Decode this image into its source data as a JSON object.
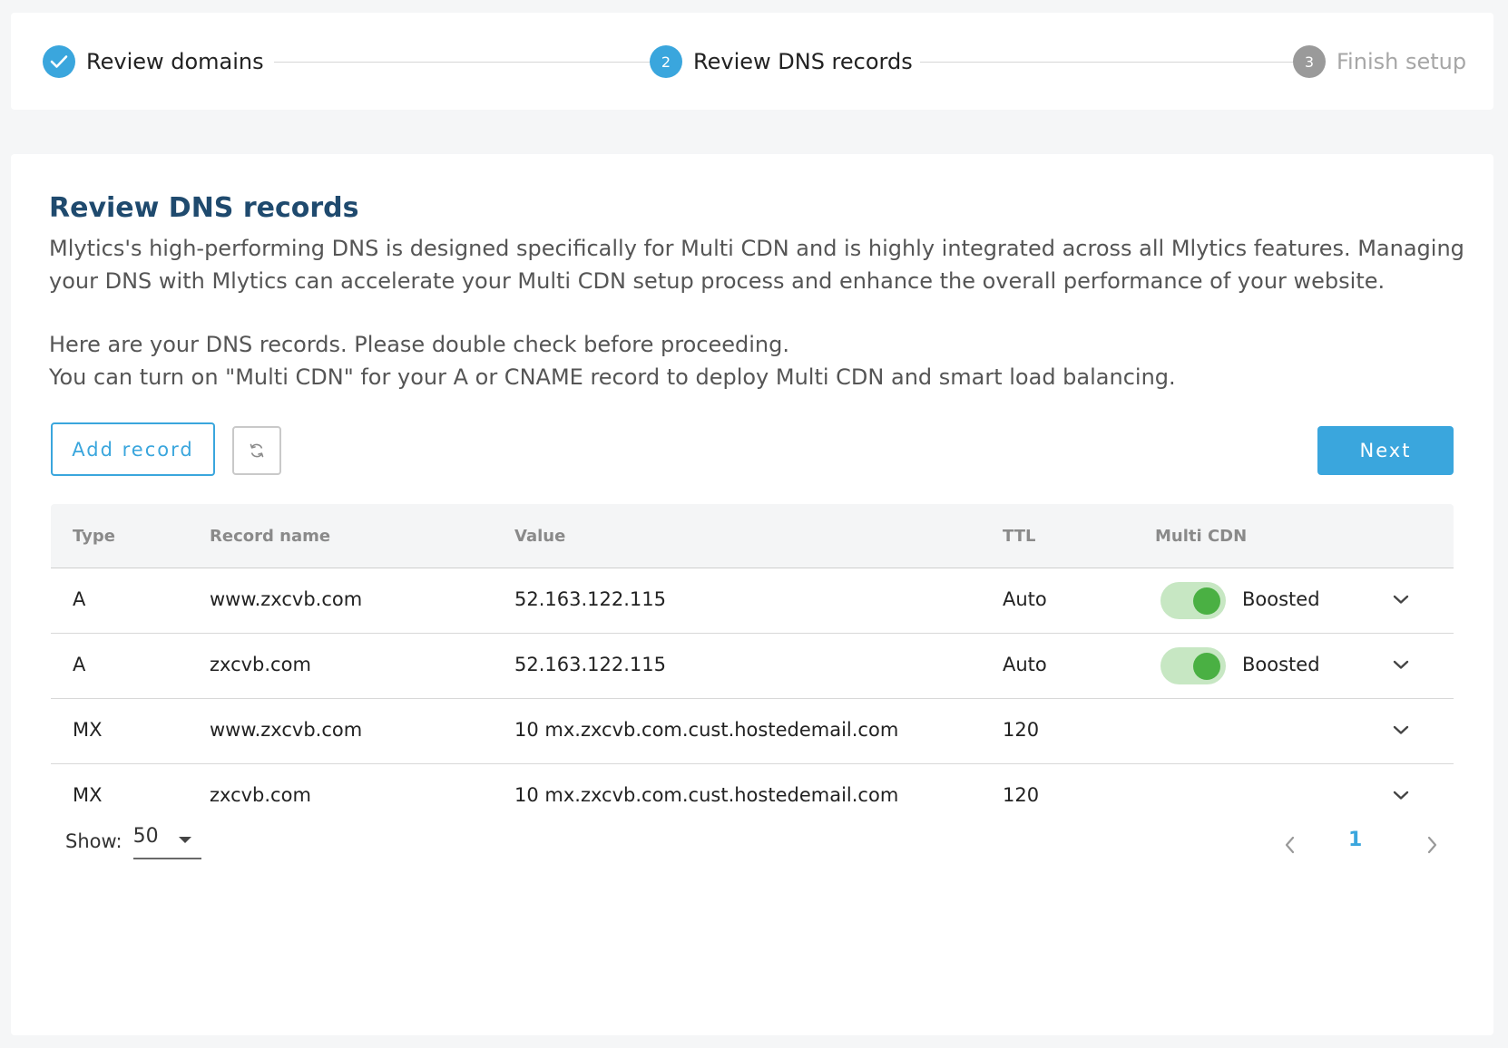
{
  "stepper": {
    "steps": [
      {
        "number": "",
        "label": "Review domains",
        "state": "completed"
      },
      {
        "number": "2",
        "label": "Review DNS records",
        "state": "active"
      },
      {
        "number": "3",
        "label": "Finish setup",
        "state": "pending"
      }
    ]
  },
  "main": {
    "title": "Review DNS records",
    "description": "Mlytics's high-performing DNS is designed specifically for Multi CDN and is highly integrated across all Mlytics features. Managing your DNS with Mlytics can accelerate your Multi CDN setup process and enhance the overall performance of your website.",
    "instructions_line1": "Here are your DNS records. Please double check before proceeding.",
    "instructions_line2": "You can turn on \"Multi CDN\" for your A or CNAME record to deploy Multi CDN and smart load balancing."
  },
  "toolbar": {
    "add_record_label": "Add record",
    "refresh_icon": "refresh-icon",
    "next_label": "Next"
  },
  "table": {
    "columns": [
      "Type",
      "Record name",
      "Value",
      "TTL",
      "Multi CDN"
    ],
    "rows": [
      {
        "type": "A",
        "name": "www.zxcvb.com",
        "value": "52.163.122.115",
        "ttl": "Auto",
        "multi_cdn": true,
        "multi_cdn_label": "Boosted"
      },
      {
        "type": "A",
        "name": "zxcvb.com",
        "value": "52.163.122.115",
        "ttl": "Auto",
        "multi_cdn": true,
        "multi_cdn_label": "Boosted"
      },
      {
        "type": "MX",
        "name": "www.zxcvb.com",
        "value": "10 mx.zxcvb.com.cust.hostedemail.com",
        "ttl": "120",
        "multi_cdn": false,
        "multi_cdn_label": ""
      },
      {
        "type": "MX",
        "name": "zxcvb.com",
        "value": "10 mx.zxcvb.com.cust.hostedemail.com",
        "ttl": "120",
        "multi_cdn": false,
        "multi_cdn_label": ""
      }
    ]
  },
  "footer": {
    "show_label": "Show:",
    "page_size": "50",
    "current_page": "1"
  },
  "colors": {
    "accent": "#3aa6dd",
    "title": "#1f4a6e",
    "toggle_on": "#4ab043",
    "toggle_track": "#c7e7c3"
  }
}
